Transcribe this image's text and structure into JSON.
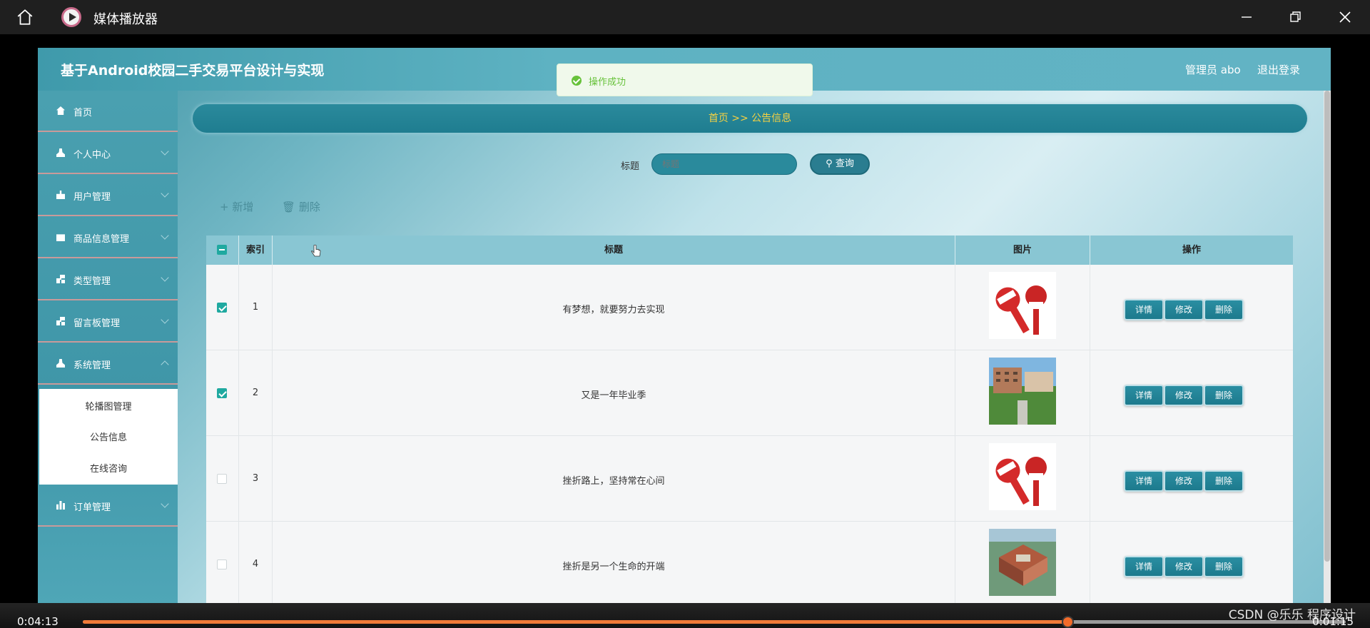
{
  "window": {
    "title": "媒体播放器"
  },
  "app": {
    "site_title": "基于Android校园二手交易平台设计与实现",
    "user_label": "管理员 abo",
    "logout_label": "退出登录"
  },
  "toast": {
    "text": "操作成功"
  },
  "sidebar": {
    "items": [
      {
        "label": "首页",
        "icon": "home-icon"
      },
      {
        "label": "个人中心",
        "icon": "user-icon"
      },
      {
        "label": "用户管理",
        "icon": "thumb-icon"
      },
      {
        "label": "商品信息管理",
        "icon": "box-icon"
      },
      {
        "label": "类型管理",
        "icon": "grid-icon"
      },
      {
        "label": "留言板管理",
        "icon": "grid-icon"
      },
      {
        "label": "系统管理",
        "icon": "user-icon"
      },
      {
        "label": "订单管理",
        "icon": "bar-chart-icon"
      }
    ],
    "submenu": [
      "轮播图管理",
      "公告信息",
      "在线咨询"
    ]
  },
  "breadcrumb": {
    "text": "首页 >> 公告信息"
  },
  "search": {
    "label": "标题",
    "placeholder": "标题",
    "button": "查询"
  },
  "toolbar": {
    "add_label": "+ 新增",
    "delete_label": "删除"
  },
  "table": {
    "headers": [
      "索引",
      "标题",
      "图片",
      "操作"
    ],
    "rows": [
      {
        "index": "1",
        "title": "有梦想，就要努力去实现",
        "checked": true,
        "image": "news-microphone"
      },
      {
        "index": "2",
        "title": "又是一年毕业季",
        "checked": true,
        "image": "campus-building"
      },
      {
        "index": "3",
        "title": "挫折路上，坚持常在心间",
        "checked": false,
        "image": "news-microphone"
      },
      {
        "index": "4",
        "title": "挫折是另一个生命的开端",
        "checked": false,
        "image": "campus-aerial"
      }
    ],
    "actions": [
      "详情",
      "修改",
      "删除"
    ]
  },
  "player": {
    "elapsed": "0:04:13",
    "remaining": "0:01:15",
    "progress": 0.78,
    "watermark": "CSDN @乐乐 程序设计"
  },
  "colors": {
    "accent": "#1f7d90",
    "breadcrumb_text": "#f5d142",
    "progress": "#f07a38",
    "success": "#67c23a"
  }
}
